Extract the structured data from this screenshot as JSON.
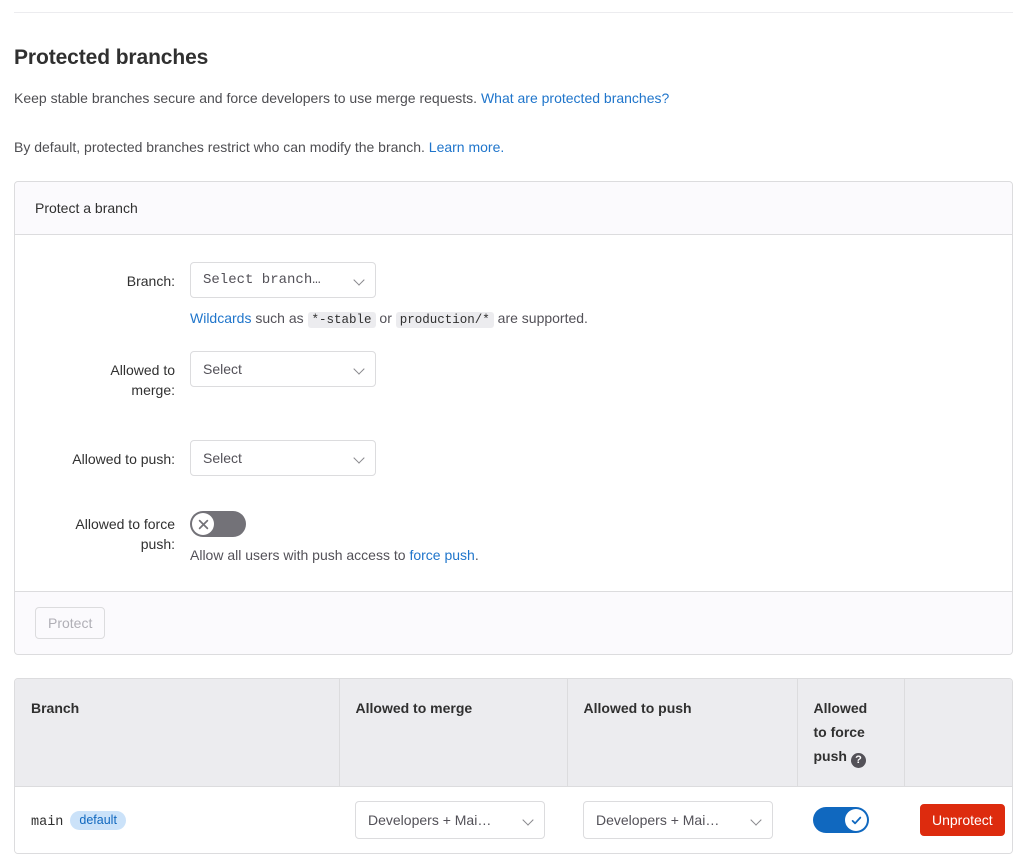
{
  "page": {
    "title": "Protected branches",
    "lead_1_text": "Keep stable branches secure and force developers to use merge requests. ",
    "lead_1_link": "What are protected branches?",
    "lead_2_text": "By default, protected branches restrict who can modify the branch. ",
    "lead_2_link": "Learn more."
  },
  "card": {
    "header": "Protect a branch",
    "fields": {
      "branch_label": "Branch:",
      "branch_value": "Select branch…",
      "merge_label_line1": "Allowed to",
      "merge_label_line2": "merge:",
      "merge_value": "Select",
      "push_label": "Allowed to push:",
      "push_value": "Select",
      "force_label_line1": "Allowed to force",
      "force_label_line2": "push:"
    },
    "wildcard_hint": {
      "link": "Wildcards",
      "mid1": " such as ",
      "code1": "*-stable",
      "mid2": " or ",
      "code2": "production/*",
      "tail": " are supported."
    },
    "force_push_hint": {
      "text": "Allow all users with push access to ",
      "link": "force push",
      "tail": "."
    },
    "force_push_enabled": false,
    "submit_label": "Protect"
  },
  "table": {
    "headers": {
      "branch": "Branch",
      "merge": "Allowed to merge",
      "push": "Allowed to push",
      "force_line1": "Allowed",
      "force_line2": "to force",
      "force_line3": "push",
      "force_help_glyph": "?",
      "action": ""
    },
    "rows": [
      {
        "branch": "main",
        "badge": "default",
        "merge": "Developers + Mai…",
        "push": "Developers + Mai…",
        "force_enabled": true,
        "action_label": "Unprotect"
      }
    ]
  },
  "colors": {
    "link": "#1f75cb",
    "toggle_on": "#1068bf",
    "toggle_off": "#737278",
    "danger": "#dd2b0e",
    "badge_bg": "#cbe2f9",
    "badge_text": "#1068bf"
  }
}
